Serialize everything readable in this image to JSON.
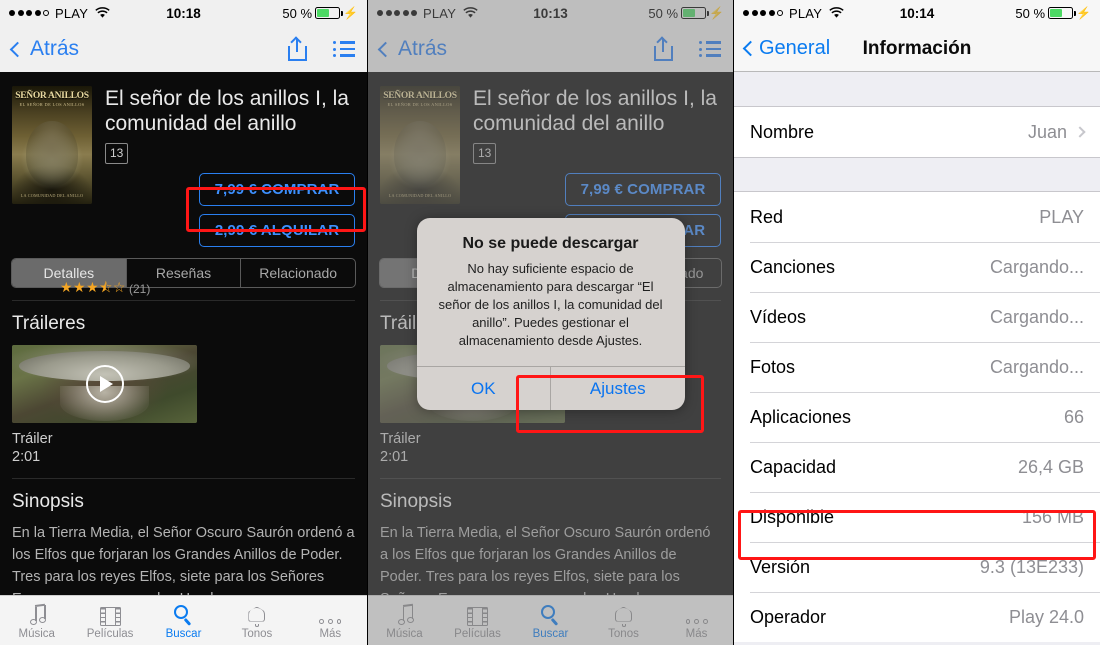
{
  "panels": [
    {
      "status": {
        "carrier": "PLAY",
        "signal_filled": 4,
        "signal_total": 5,
        "wifi_icon": "wifi-icon",
        "time": "10:18",
        "battery": "50 %",
        "battery_pct": 50,
        "charging": true
      },
      "nav": {
        "back_label": "Atrás",
        "share_icon": "share-icon",
        "list_icon": "list-icon"
      },
      "movie": {
        "title": "El señor de los anillos I, la comunidad del anillo",
        "age_rating": "13",
        "poster_line1": "SEÑOR ANILLOS",
        "poster_line2": "EL SEÑOR DE LOS ANILLOS",
        "poster_line3": "LA COMUNIDAD DEL ANILLO",
        "buy_label": "7,99 € COMPRAR",
        "rent_label": "2,99 € ALQUILAR",
        "stars": "★★★⯪☆",
        "review_count": "(21)"
      },
      "segments": [
        {
          "label": "Detalles",
          "active": true
        },
        {
          "label": "Reseñas",
          "active": false
        },
        {
          "label": "Relacionado",
          "active": false
        }
      ],
      "trailers": {
        "heading": "Tráileres",
        "name": "Tráiler",
        "duration": "2:01",
        "play_icon": "play-icon"
      },
      "synopsis": {
        "heading": "Sinopsis",
        "text": "En la Tierra Media, el Señor Oscuro Saurón ordenó a los Elfos que forjaran los Grandes Anillos de Poder. Tres para los reyes Elfos, siete para los Señores Enanos, y nueve para los Hombres"
      },
      "tabs": [
        {
          "label": "Música",
          "icon": "music-note-icon",
          "active": false
        },
        {
          "label": "Películas",
          "icon": "film-icon",
          "active": false
        },
        {
          "label": "Buscar",
          "icon": "search-icon",
          "active": true
        },
        {
          "label": "Tonos",
          "icon": "bell-icon",
          "active": false
        },
        {
          "label": "Más",
          "icon": "ellipsis-icon",
          "active": false
        }
      ]
    },
    {
      "status": {
        "carrier": "PLAY",
        "signal_filled": 5,
        "signal_total": 5,
        "wifi_icon": "wifi-icon",
        "time": "10:13",
        "battery": "50 %",
        "battery_pct": 50,
        "charging": true
      },
      "alert": {
        "title": "No se puede descargar",
        "message": "No hay suficiente espacio de almacenamiento para descargar “El señor de los anillos I, la comunidad del anillo”. Puedes gestionar el almacenamiento desde Ajustes.",
        "ok_label": "OK",
        "settings_label": "Ajustes"
      }
    },
    {
      "status": {
        "carrier": "PLAY",
        "signal_filled": 4,
        "signal_total": 5,
        "wifi_icon": "wifi-icon",
        "time": "10:14",
        "battery": "50 %",
        "battery_pct": 50,
        "charging": true
      },
      "nav": {
        "back_label": "General",
        "title": "Información"
      },
      "name_row": {
        "label": "Nombre",
        "value": "Juan",
        "chevron": "chevron-right-icon"
      },
      "info_rows": [
        {
          "label": "Red",
          "value": "PLAY"
        },
        {
          "label": "Canciones",
          "value": "Cargando..."
        },
        {
          "label": "Vídeos",
          "value": "Cargando..."
        },
        {
          "label": "Fotos",
          "value": "Cargando..."
        },
        {
          "label": "Aplicaciones",
          "value": "66"
        },
        {
          "label": "Capacidad",
          "value": "26,4 GB"
        },
        {
          "label": "Disponible",
          "value": "156 MB"
        },
        {
          "label": "Versión",
          "value": "9.3 (13E233)"
        },
        {
          "label": "Operador",
          "value": "Play 24.0"
        }
      ]
    }
  ],
  "colors": {
    "accent_blue": "#0a7bf0",
    "highlight_red": "#ff1616",
    "star_orange": "#f5a623",
    "battery_green": "#4cd964"
  }
}
